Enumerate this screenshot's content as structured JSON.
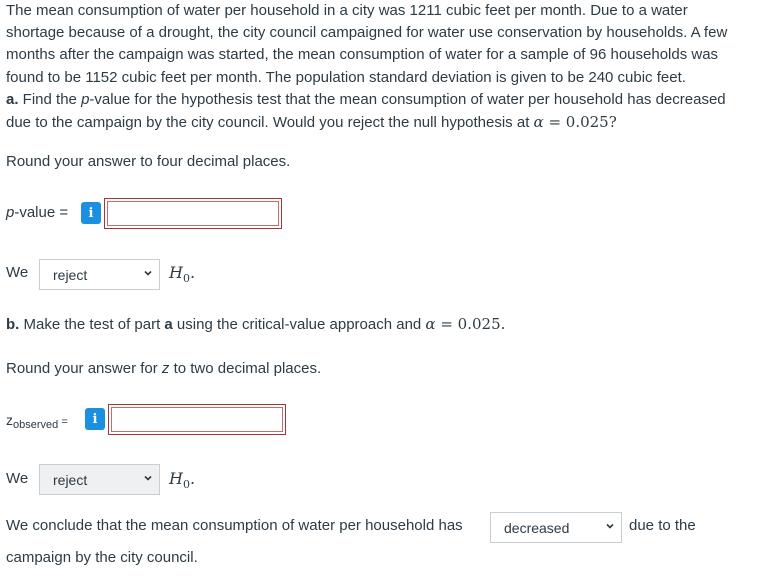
{
  "question": {
    "intro_line1": "The mean consumption of water per household in a city was 1211 cubic feet per month. Due to a water",
    "intro_line2": "shortage because of a drought, the city council campaigned for water use conservation by households. A few",
    "intro_line3": "months after the campaign was started, the mean consumption of water for a sample of 96 households was",
    "intro_line4": "found to be 1152 cubic feet per month. The population standard deviation is given to be 240 cubic feet.",
    "part_a_prefix": "a.",
    "part_a_text1": " Find the ",
    "part_a_p": "p",
    "part_a_text2": "-value for the hypothesis test that the mean consumption of water per household has decreased",
    "part_a_text3": "due to the campaign by the city council. Would you reject the null hypothesis at ",
    "alpha_symbol": "α",
    "alpha_eq": " = 0.025?",
    "round_a": "Round your answer to four decimal places."
  },
  "part_a": {
    "pvalue_label_p": "p",
    "pvalue_label_rest": "-value =",
    "info_glyph": "i",
    "pvalue_value": "",
    "we_label": "We",
    "reject_select": "reject",
    "h0_letter": "H",
    "h0_sub": "0",
    "h0_dot": "."
  },
  "part_b": {
    "prefix": "b.",
    "text1": " Make the test of part ",
    "bold_a": "a",
    "text2": " using the critical-value approach and ",
    "alpha_symbol": "α",
    "alpha_eq": " = 0.025.",
    "round_b_1": "Round your answer for ",
    "round_b_z": "z",
    "round_b_2": " to two decimal places.",
    "z_label": "z",
    "z_sub": "observed",
    "z_eq": " =",
    "info_glyph": "i",
    "z_value": "",
    "we_label": "We",
    "reject_select": "reject",
    "h0_letter": "H",
    "h0_sub": "0",
    "h0_dot": ".",
    "conclude_text": "We conclude that the mean consumption of water per household has",
    "conclude_select": "decreased",
    "due_to": "due to the",
    "campaign_text": "campaign by the city council."
  },
  "colors": {
    "text": "#2d3b45",
    "info_blue": "#1b8fe1",
    "error_border": "#a6353a"
  }
}
